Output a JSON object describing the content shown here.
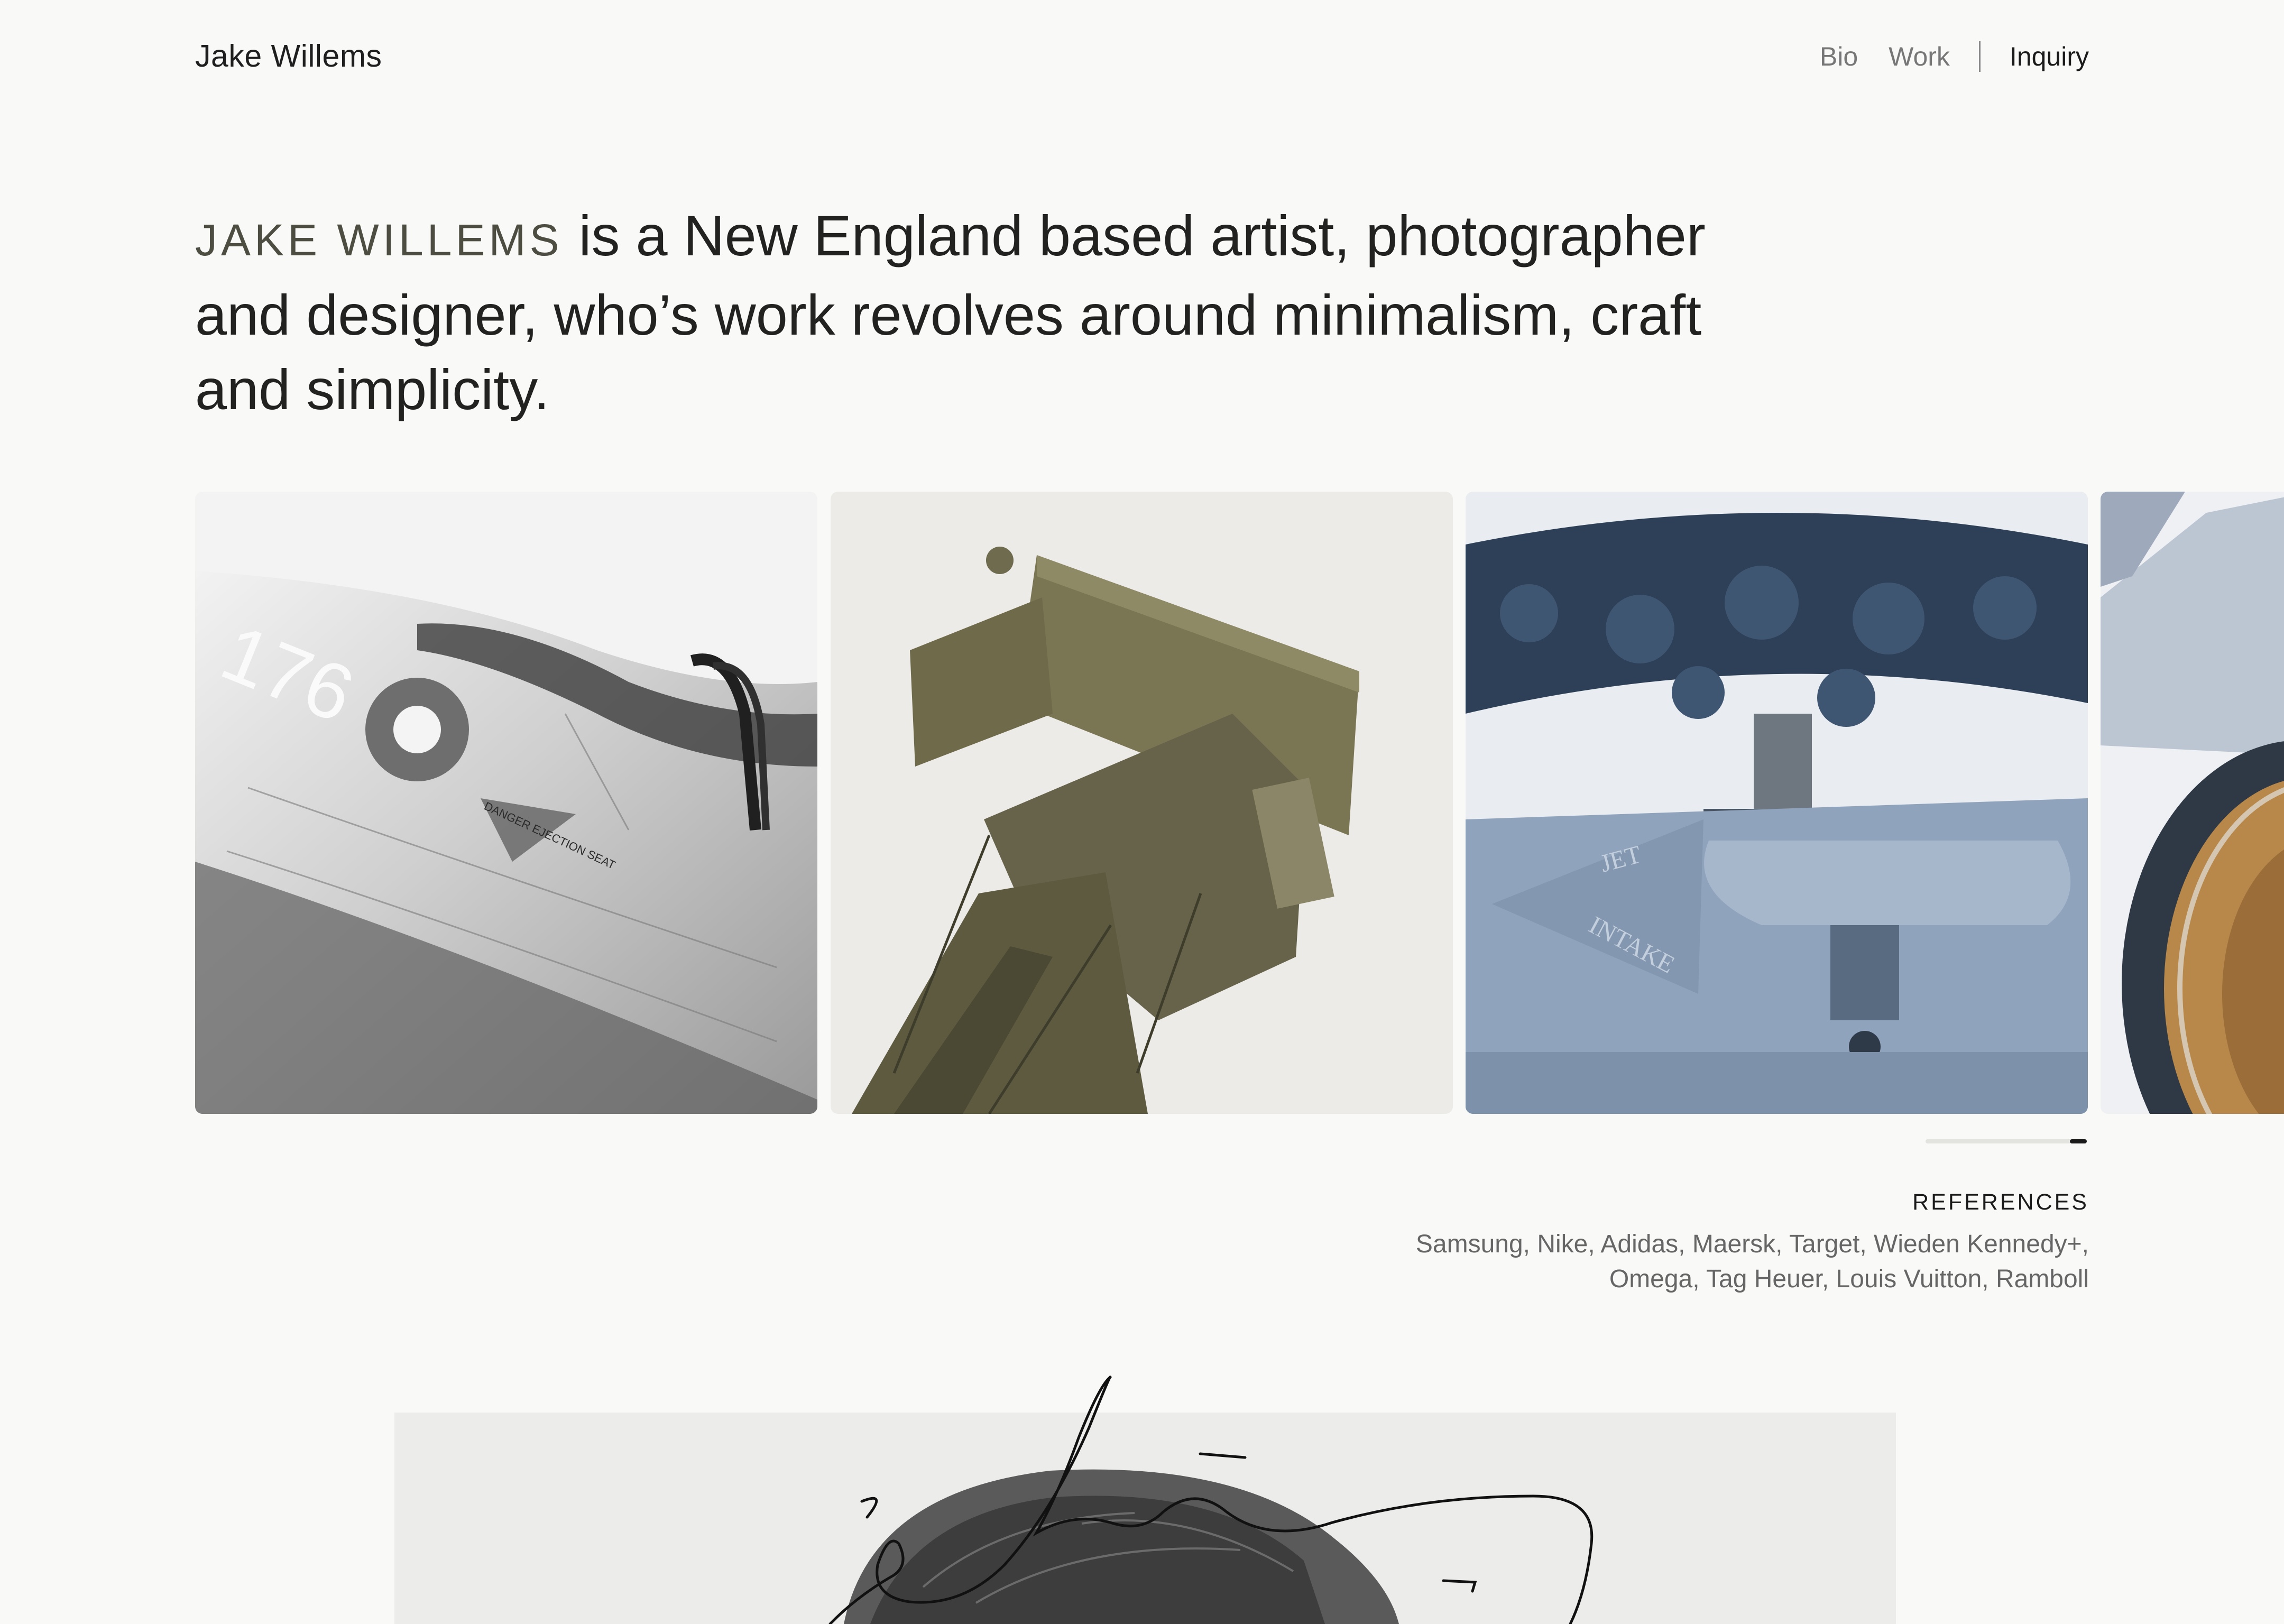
{
  "header": {
    "logo": "Jake Willems",
    "nav": {
      "bio": "Bio",
      "work": "Work",
      "inquiry": "Inquiry"
    }
  },
  "hero": {
    "name": "Jake Willems",
    "line1_rest": " is a New England based artist, photographer",
    "line2": "and designer, who’s work revolves around minimalism, craft",
    "line3": "and simplicity."
  },
  "gallery": {
    "jet_number": "176",
    "ejection_label": "DANGER EJECTION SEAT",
    "intake_label_1": "JET",
    "intake_label_2": "INTAKE",
    "scroll_progress": 1.0
  },
  "references": {
    "title": "REFERENCES",
    "line1": "Samsung, Nike, Adidas, Maersk, Target, Wieden Kennedy+,",
    "line2": "Omega, Tag Heuer, Louis Vuitton, Ramboll"
  },
  "colors": {
    "background": "#f9f9f7",
    "text": "#222220",
    "muted": "#777777",
    "name_accent": "#4d4d42"
  }
}
